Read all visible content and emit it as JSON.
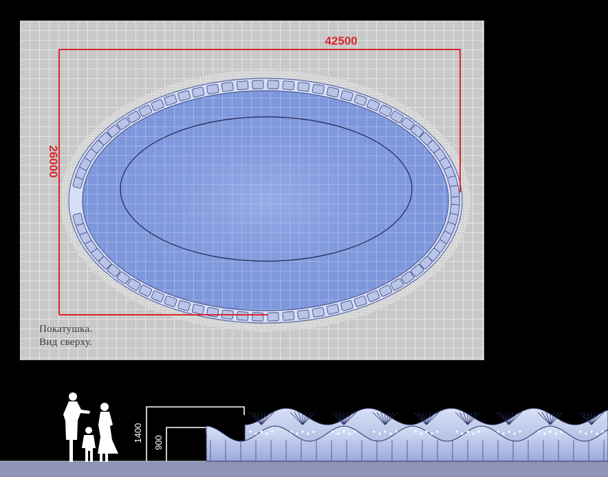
{
  "plan": {
    "dimension_width": "42500",
    "dimension_height": "26000",
    "caption_line1": "Покатушка.",
    "caption_line2": "Вид сверху."
  },
  "elevation": {
    "height_high": "1400",
    "height_low": "900"
  },
  "colors": {
    "background": "#000000",
    "grid_bg": "#c8c8c8",
    "grid_line": "#f2f2f2",
    "ice": "#7f98dc",
    "dimension_red": "#d8262c",
    "track_block": "#b9c4e8",
    "ground": "#8f93b5"
  },
  "icons": [
    "person-adult-silhouette",
    "person-child-silhouette",
    "person-girl-silhouette"
  ]
}
